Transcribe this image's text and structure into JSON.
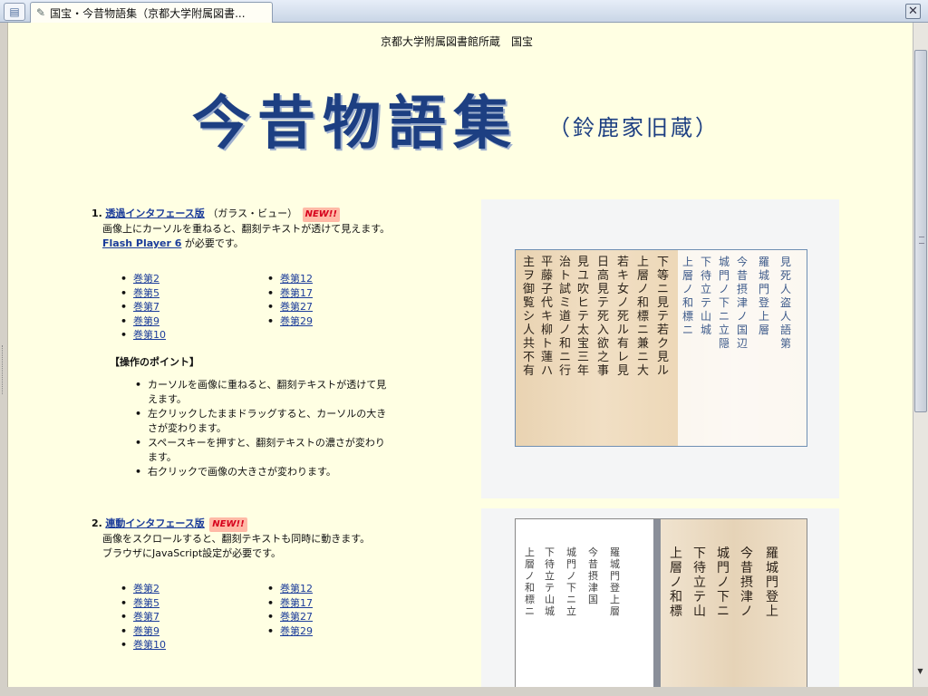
{
  "tab": {
    "title": "国宝・今昔物語集（京都大学附属図書..."
  },
  "header": {
    "owner": "京都大学附属図書館所蔵",
    "designation": "国宝",
    "main_title": "今昔物語集",
    "sub_title": "（鈴鹿家旧蔵）"
  },
  "section1": {
    "number": "1.",
    "link": "透過インタフェース版",
    "paren": "（ガラス・ビュー）",
    "badge": "NEW!!",
    "desc": "画像上にカーソルを重ねると、翻刻テキストが透けて見えます。",
    "flash_link": "Flash Player 6",
    "flash_suffix": "が必要です。",
    "volumes_col1": [
      "巻第2",
      "巻第5",
      "巻第7",
      "巻第9",
      "巻第10"
    ],
    "volumes_col2": [
      "巻第12",
      "巻第17",
      "巻第27",
      "巻第29"
    ],
    "points_title": "【操作のポイント】",
    "points": [
      "カーソルを画像に重ねると、翻刻テキストが透けて見えます。",
      "左クリックしたままドラッグすると、カーソルの大きさが変わります。",
      "スペースキーを押すと、翻刻テキストの濃さが変わります。",
      "右クリックで画像の大きさが変わります。"
    ]
  },
  "section2": {
    "number": "2.",
    "link": "連動インタフェース版",
    "badge": "NEW!!",
    "desc1": "画像をスクロールすると、翻刻テキストも同時に動きます。",
    "desc2": "ブラウザにJavaScript設定が必要です。",
    "volumes_col1": [
      "巻第2",
      "巻第5",
      "巻第7",
      "巻第9",
      "巻第10"
    ],
    "volumes_col2": [
      "巻第12",
      "巻第17",
      "巻第27",
      "巻第29"
    ]
  },
  "icons": {
    "tab_page": "page-icon",
    "tab_pin": "pin-icon",
    "close": "close-icon"
  },
  "colors": {
    "page_bg": "#ffffe3",
    "title_blue": "#1d3f82",
    "link_blue": "#1b3c9a",
    "badge_red": "#d6001c"
  }
}
